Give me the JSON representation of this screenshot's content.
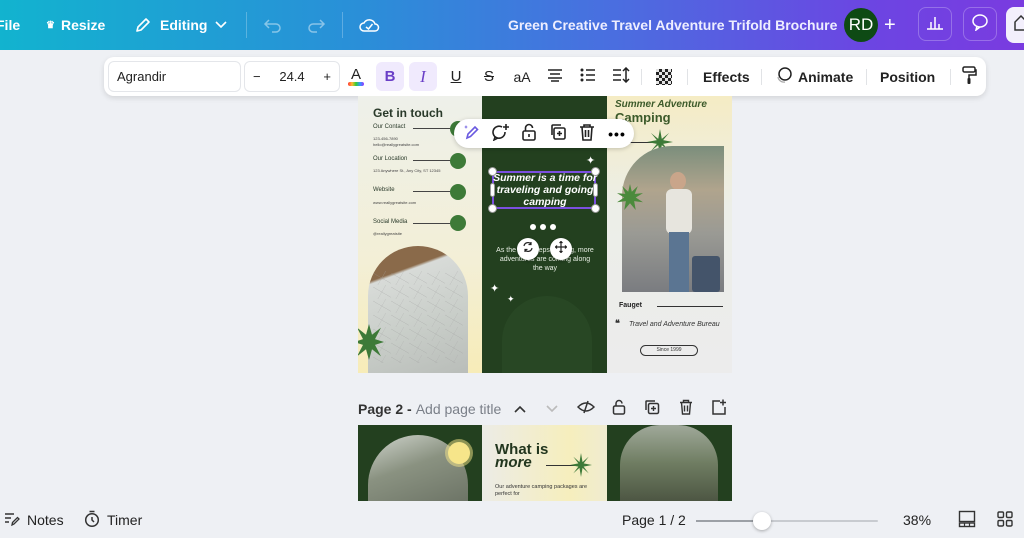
{
  "topbar": {
    "file_label": "File",
    "resize_label": "Resize",
    "editing_label": "Editing",
    "document_title": "Green Creative Travel Adventure Trifold Brochure",
    "avatar_initials": "RD",
    "icons": [
      "crown-icon",
      "pencil-icon",
      "chevron-down-icon",
      "undo-icon",
      "redo-icon",
      "cloud-check-icon",
      "plus-icon",
      "analytics-icon",
      "comment-icon",
      "share-icon"
    ],
    "gradient_start": "#12b3cf",
    "gradient_end": "#7a3be0"
  },
  "text_toolbar": {
    "font_family": "Agrandir",
    "font_size": "24.4",
    "decrease_label": "−",
    "increase_label": "+",
    "bold_label": "B",
    "italic_label": "I",
    "underline_label": "U",
    "strike_label": "S",
    "case_label": "aA",
    "effects_label": "Effects",
    "animate_label": "Animate",
    "position_label": "Position",
    "bold_active": true,
    "italic_active": true,
    "active_color": "#6a3fc7"
  },
  "page1": {
    "panel_left": {
      "title": "Get in touch",
      "contacts": [
        {
          "label": "Our Contact",
          "value": "123-456-7890\nhello@reallygreatsite.com"
        },
        {
          "label": "Our Location",
          "value": "123 Anywhere St., Any City, ST 12345"
        },
        {
          "label": "Website",
          "value": "www.reallygreatsite.com"
        },
        {
          "label": "Social Media",
          "value": "@reallygreatsite"
        }
      ]
    },
    "panel_middle": {
      "heading": "Summer is a time for traveling and going camping",
      "body": "As the sun keeps shining, more adventures are coming along the way"
    },
    "panel_right": {
      "title_line1": "Summer Adventure",
      "title_line2": "Camping",
      "brand": "Fauget",
      "bureau": "Travel and Adventure Bureau",
      "since": "Since 1999"
    },
    "accent_green": "#23401f",
    "dot_green": "#3d7a38"
  },
  "element_toolbar": {
    "icons": [
      "magic-edit-icon",
      "add-comment-icon",
      "unlock-icon",
      "duplicate-icon",
      "delete-icon",
      "more-icon"
    ]
  },
  "page2": {
    "label": "Page 2 - ",
    "title_placeholder": "Add page title",
    "heading_line1": "What is",
    "heading_line2": "more",
    "body": "Our adventure camping packages are perfect for"
  },
  "bottombar": {
    "notes_label": "Notes",
    "timer_label": "Timer",
    "page_indicator": "Page 1 / 2",
    "zoom_value": "38%",
    "zoom_fraction": 0.36
  }
}
